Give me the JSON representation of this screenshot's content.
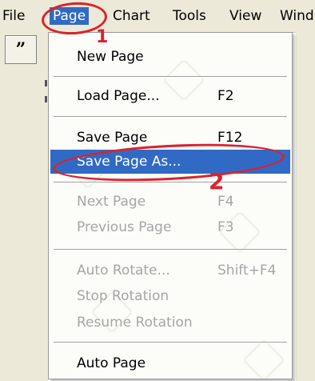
{
  "menubar": {
    "items": [
      "File",
      "Page",
      "Chart",
      "Tools",
      "View",
      "Wind"
    ],
    "active_index": 1
  },
  "toolbar": {
    "quote_button": "”"
  },
  "menu": {
    "items": [
      {
        "label": "New Page",
        "key": "",
        "disabled": false
      },
      {
        "label": "Load Page...",
        "key": "F2",
        "disabled": false
      },
      {
        "label": "Save Page",
        "key": "F12",
        "disabled": false
      },
      {
        "label": "Save Page As...",
        "key": "",
        "disabled": false,
        "highlighted": true
      },
      {
        "label": "Next Page",
        "key": "F4",
        "disabled": true
      },
      {
        "label": "Previous Page",
        "key": "F3",
        "disabled": true
      },
      {
        "label": "Auto Rotate...",
        "key": "Shift+F4",
        "disabled": true
      },
      {
        "label": "Stop Rotation",
        "key": "",
        "disabled": true
      },
      {
        "label": "Resume Rotation",
        "key": "",
        "disabled": true
      },
      {
        "label": "Auto Page",
        "key": "",
        "disabled": false
      }
    ]
  },
  "annotations": {
    "step1": "1",
    "step2": "2",
    "color": "#d9232e"
  },
  "colors": {
    "highlight": "#316ac5",
    "menubar_bg": "#ece9d8",
    "disabled_text": "#a6a6a6"
  }
}
